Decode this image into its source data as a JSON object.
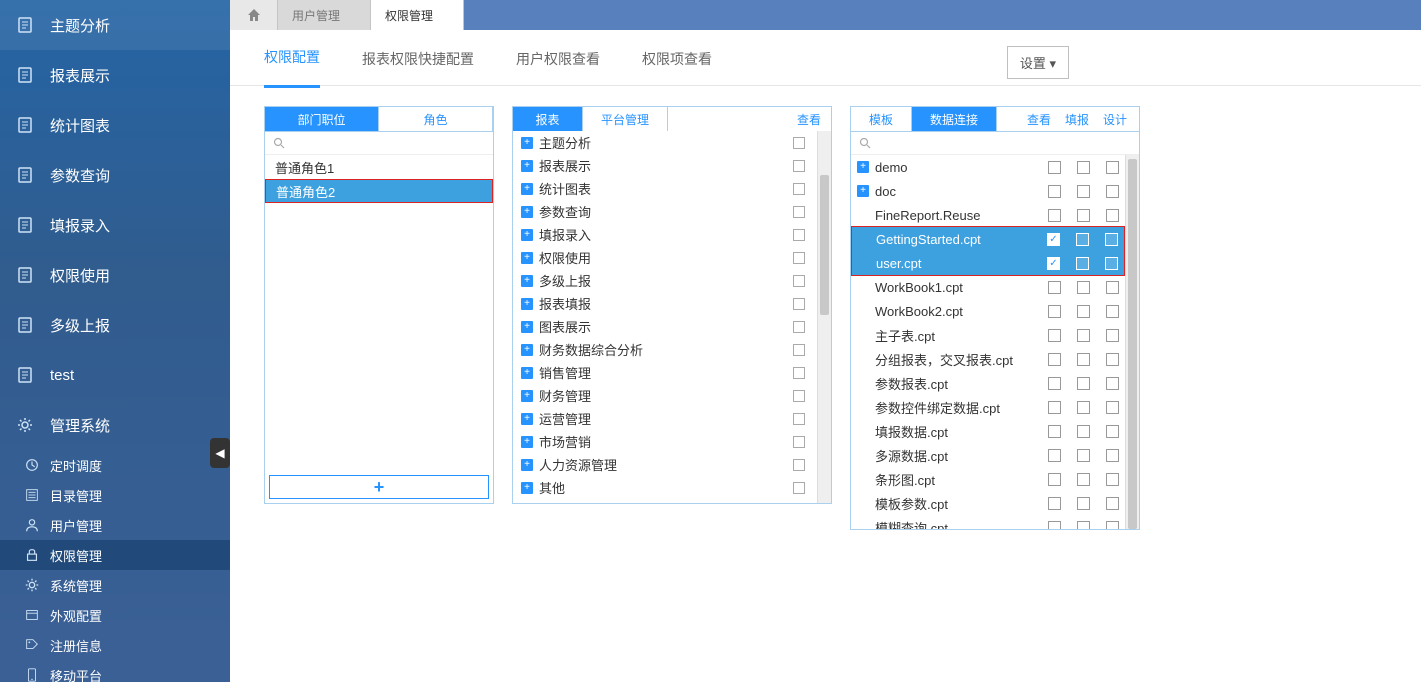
{
  "sidebar": {
    "items": [
      {
        "label": "主题分析",
        "icon": "doc"
      },
      {
        "label": "报表展示",
        "icon": "doc"
      },
      {
        "label": "统计图表",
        "icon": "doc"
      },
      {
        "label": "参数查询",
        "icon": "doc"
      },
      {
        "label": "填报录入",
        "icon": "doc"
      },
      {
        "label": "权限使用",
        "icon": "doc"
      },
      {
        "label": "多级上报",
        "icon": "doc"
      },
      {
        "label": "test",
        "icon": "doc"
      },
      {
        "label": "管理系统",
        "icon": "gear"
      }
    ],
    "subitems": [
      {
        "label": "定时调度",
        "icon": "clock"
      },
      {
        "label": "目录管理",
        "icon": "list"
      },
      {
        "label": "用户管理",
        "icon": "user"
      },
      {
        "label": "权限管理",
        "icon": "lock",
        "active": true
      },
      {
        "label": "系统管理",
        "icon": "gear"
      },
      {
        "label": "外观配置",
        "icon": "window"
      },
      {
        "label": "注册信息",
        "icon": "tag"
      },
      {
        "label": "移动平台",
        "icon": "mobile"
      }
    ]
  },
  "topbar": {
    "tabs": [
      {
        "label": "用户管理"
      },
      {
        "label": "权限管理",
        "active": true
      }
    ]
  },
  "settings_label": "设置 ▾",
  "sub_tabs": [
    {
      "label": "权限配置",
      "active": true
    },
    {
      "label": "报表权限快捷配置"
    },
    {
      "label": "用户权限查看"
    },
    {
      "label": "权限项查看"
    }
  ],
  "panel_roles": {
    "tabs": [
      {
        "label": "部门职位",
        "active": true
      },
      {
        "label": "角色"
      }
    ],
    "rows": [
      {
        "label": "普通角色1"
      },
      {
        "label": "普通角色2",
        "selected": true,
        "redbox": true
      }
    ],
    "add_label": "+"
  },
  "panel_reports": {
    "tabs": [
      {
        "label": "报表",
        "active": true
      },
      {
        "label": "平台管理"
      }
    ],
    "link": "查看",
    "rows": [
      {
        "label": "主题分析"
      },
      {
        "label": "报表展示"
      },
      {
        "label": "统计图表"
      },
      {
        "label": "参数查询"
      },
      {
        "label": "填报录入"
      },
      {
        "label": "权限使用"
      },
      {
        "label": "多级上报"
      },
      {
        "label": "报表填报"
      },
      {
        "label": "图表展示"
      },
      {
        "label": "财务数据综合分析"
      },
      {
        "label": "销售管理"
      },
      {
        "label": "财务管理"
      },
      {
        "label": "运营管理"
      },
      {
        "label": "市场营销"
      },
      {
        "label": "人力资源管理"
      },
      {
        "label": "其他"
      }
    ]
  },
  "panel_templates": {
    "tabs": [
      {
        "label": "模板"
      },
      {
        "label": "数据连接",
        "active": true
      }
    ],
    "cols": [
      "查看",
      "填报",
      "设计"
    ],
    "rows": [
      {
        "label": "demo",
        "folder": true,
        "checks": [
          false,
          false,
          false
        ]
      },
      {
        "label": "doc",
        "folder": true,
        "checks": [
          false,
          false,
          false
        ]
      },
      {
        "label": "FineReport.Reuse",
        "checks": [
          false,
          false,
          false
        ]
      },
      {
        "label": "GettingStarted.cpt",
        "selected": true,
        "checks": [
          true,
          false,
          false
        ],
        "redbox": "start"
      },
      {
        "label": "user.cpt",
        "selected": true,
        "checks": [
          true,
          false,
          false
        ],
        "redbox": "end"
      },
      {
        "label": "WorkBook1.cpt",
        "checks": [
          false,
          false,
          false
        ]
      },
      {
        "label": "WorkBook2.cpt",
        "checks": [
          false,
          false,
          false
        ]
      },
      {
        "label": "主子表.cpt",
        "checks": [
          false,
          false,
          false
        ]
      },
      {
        "label": "分组报表，交叉报表.cpt",
        "checks": [
          false,
          false,
          false
        ]
      },
      {
        "label": "参数报表.cpt",
        "checks": [
          false,
          false,
          false
        ]
      },
      {
        "label": "参数控件绑定数据.cpt",
        "checks": [
          false,
          false,
          false
        ]
      },
      {
        "label": "填报数据.cpt",
        "checks": [
          false,
          false,
          false
        ]
      },
      {
        "label": "多源数据.cpt",
        "checks": [
          false,
          false,
          false
        ]
      },
      {
        "label": "条形图.cpt",
        "checks": [
          false,
          false,
          false
        ]
      },
      {
        "label": "模板参数.cpt",
        "checks": [
          false,
          false,
          false
        ]
      },
      {
        "label": "模糊查询.cpt",
        "checks": [
          false,
          false,
          false
        ]
      }
    ]
  }
}
